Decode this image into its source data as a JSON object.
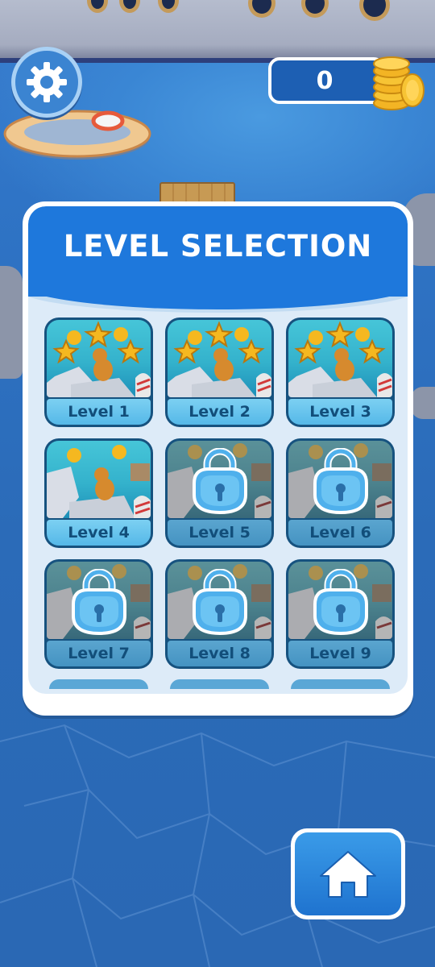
{
  "hud": {
    "settings_icon": "gear-icon",
    "coin_count": "0",
    "coin_icon": "coin-stack-icon"
  },
  "panel": {
    "title": "LEVEL SELECTION",
    "levels": [
      {
        "label": "Level 1",
        "status": "unlocked",
        "stars": 3
      },
      {
        "label": "Level 2",
        "status": "unlocked",
        "stars": 3
      },
      {
        "label": "Level 3",
        "status": "unlocked",
        "stars": 3
      },
      {
        "label": "Level 4",
        "status": "unlocked",
        "stars": 0
      },
      {
        "label": "Level 5",
        "status": "locked",
        "stars": 0
      },
      {
        "label": "Level 6",
        "status": "locked",
        "stars": 0
      },
      {
        "label": "Level 7",
        "status": "locked",
        "stars": 0
      },
      {
        "label": "Level 8",
        "status": "locked",
        "stars": 0
      },
      {
        "label": "Level 9",
        "status": "locked",
        "stars": 0
      }
    ]
  },
  "home_button": {
    "icon": "home-icon"
  },
  "colors": {
    "panel_header": "#1e78dc",
    "panel_body": "#ddebf8",
    "card_border": "#16527f",
    "label_text": "#124e7a",
    "star": "#f5b820",
    "lock": "#4fb0ec"
  }
}
